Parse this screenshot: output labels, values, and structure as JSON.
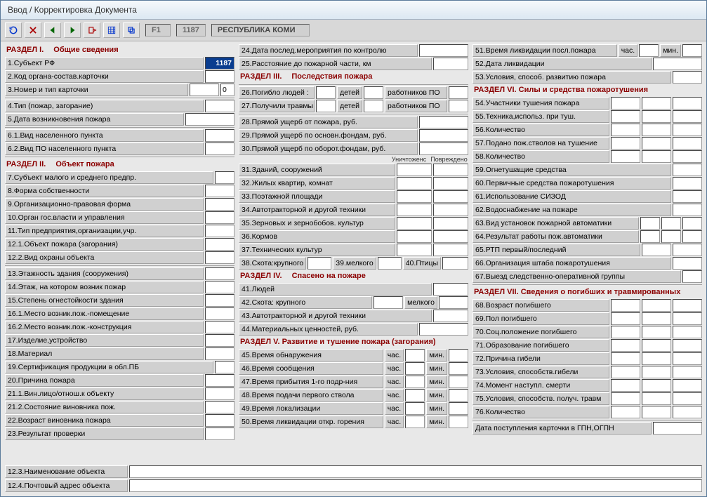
{
  "title": "Ввод / Корректировка Документа",
  "toolbar": {
    "f1": "F1",
    "code": "1187",
    "region": "РЕСПУБЛИКА КОМИ"
  },
  "sec1": {
    "h": "РАЗДЕЛ I.",
    "n": "Общие сведения"
  },
  "sec2": {
    "h": "РАЗДЕЛ II.",
    "n": "Объект пожара"
  },
  "sec3": {
    "h": "РАЗДЕЛ III.",
    "n": "Последствия пожара"
  },
  "sec4": {
    "h": "РАЗДЕЛ IV.",
    "n": "Спасено на пожаре"
  },
  "sec5": {
    "h": "РАЗДЕЛ V.",
    "n": "Развитие и тушение пожара (загорания)"
  },
  "sec6": {
    "h": "РАЗДЕЛ VI.",
    "n": "Силы и средства пожаротушения"
  },
  "sec7": {
    "h": "РАЗДЕЛ VII.",
    "n": "Сведения о погибших и травмированных"
  },
  "r": {
    "f1": "1.Субъект РФ",
    "f1v": "1187",
    "f2": "2.Код органа-состав.карточки",
    "f3": "3.Номер и тип карточки",
    "f3v2": "0",
    "f4": "4.Тип (пожар, загорание)",
    "f5": "5.Дата возникновения пожара",
    "f6_1": "6.1.Вид населенного пункта",
    "f6_2": "6.2.Вид ПО населенного пункта",
    "f7": "7.Субъект малого и среднего предпр.",
    "f8": "8.Форма собственности",
    "f9": "9.Организационно-правовая форма",
    "f10": "10.Орган гос.власти и управления",
    "f11": "11.Тип предприятия,организации,учр.",
    "f12_1": "12.1.Объект пожара (загорания)",
    "f12_2": "12.2.Вид охраны объекта",
    "f12_3": "12.3.Наименование объекта",
    "f12_4": "12.4.Почтовый адрес объекта",
    "f13": "13.Этажность здания (сооружения)",
    "f14": "14.Этаж, на котором возник пожар",
    "f15": "15.Степень огнестойкости здания",
    "f16_1": "16.1.Место возник.пож.-помещение",
    "f16_2": "16.2.Место возник.пож.-конструкция",
    "f17": "17.Изделие,устройство",
    "f18": "18.Материал",
    "f19": "19.Сертификация продукции в обл.ПБ",
    "f20": "20.Причина пожара",
    "f21_1": "21.1.Вин.лицо/отнош.к объекту",
    "f21_2": "21.2.Состояние виновника пож.",
    "f22": "22.Возраст виновника пожара",
    "f23": "23.Результат проверки",
    "f24": "24.Дата послед.мероприятия по контролю",
    "f25": "25.Расстояние до пожарной части, км",
    "f26": "26.Погибло людей :",
    "f26d": "детей",
    "f26r": "работников ПО",
    "f27": "27.Получили травмы",
    "f27d": "детей",
    "f27r": "работников ПО",
    "f28": "28.Прямой ущерб от пожара, руб.",
    "f29": "29.Прямой ущерб по основн.фондам, руб.",
    "f30": "30.Прямой ущерб по оборот.фондам, руб.",
    "dmg1": "Уничтоженс",
    "dmg2": "Повреждено",
    "f31": "31.Зданий, сооружений",
    "f32": "32.Жилых квартир, комнат",
    "f33": "33.Поэтажной площади",
    "f34": "34.Автотракторной и другой техники",
    "f35": "35.Зерновых и зернобобов. культур",
    "f36": "36.Кормов",
    "f37": "37.Технических культур",
    "f38": "38.Скота:крупного",
    "f39": "39.мелкого",
    "f40": "40.Птицы",
    "f41": "41.Людей",
    "f42": "42.Скота: крупного",
    "f42m": "мелкого",
    "f43": "43.Автотракторной и другой техники",
    "f44": "44.Материальных ценностей, руб.",
    "f45": "45.Время обнаружения",
    "chas": "час.",
    "min": "мин.",
    "f46": "46.Время сообщения",
    "f47": "47.Время прибытия 1-го подр-ния",
    "f48": "48.Время подачи первого ствола",
    "f49": "49.Время локализации",
    "f50": "50.Время ликвидации откр. горения",
    "f51": "51.Время ликвидации посл.пожара",
    "f52": "52.Дата ликвидации",
    "f53": "53.Условия, способ. развитию пожара",
    "f54": "54.Участники тушения пожара",
    "f55": "55.Техника,использ. при туш.",
    "f56": "56.Количество",
    "f57": "57.Подано пож.стволов на тушение",
    "f58": "58.Количество",
    "f59": "59.Огнетушащие средства",
    "f60": "60.Первичные средства пожаротушения",
    "f61": "61.Использование СИЗОД",
    "f62": "62.Водоснабжение на пожаре",
    "f63": "63.Вид установок пожарной автоматики",
    "f64": "64.Результат работы пож.автоматики",
    "f65": "65.РТП первый/последний",
    "f66": "66.Организация штаба пожаротушения",
    "f67": "67.Выезд следственно-оперативной группы",
    "f68": "68.Возраст погибшего",
    "f69": "69.Пол погибшего",
    "f70": "70.Соц.положение погибшего",
    "f71": "71.Образование погибшего",
    "f72": "72.Причина гибели",
    "f73": "73.Условия, способств.гибели",
    "f74": "74.Момент наступл. смерти",
    "f75": "75.Условия, способств. получ. травм",
    "f76": "76.Количество",
    "fdate": "Дата поступления карточки в ГПН,ОГПН"
  }
}
